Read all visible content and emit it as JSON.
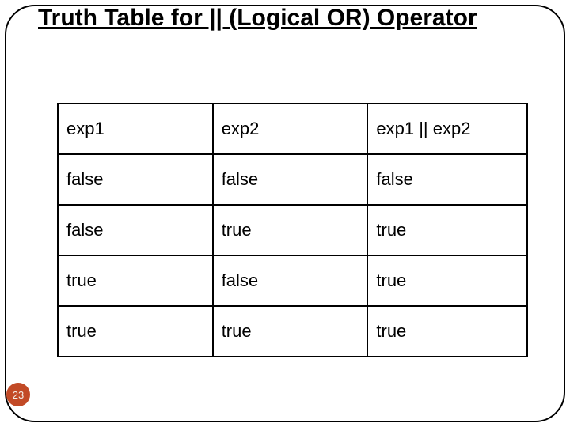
{
  "title": "Truth Table for || (Logical OR) Operator",
  "page_number": "23",
  "chart_data": {
    "type": "table",
    "title": "Truth Table for || (Logical OR) Operator",
    "columns": [
      "exp1",
      "exp2",
      "exp1 || exp2"
    ],
    "rows": [
      [
        "false",
        "false",
        "false"
      ],
      [
        "false",
        "true",
        "true"
      ],
      [
        "true",
        "false",
        "true"
      ],
      [
        "true",
        "true",
        "true"
      ]
    ]
  },
  "headers": {
    "h0": "exp1",
    "h1": "exp2",
    "h2": "exp1 || exp2"
  },
  "rows": {
    "r0": {
      "c0": "false",
      "c1": "false",
      "c2": "false"
    },
    "r1": {
      "c0": "false",
      "c1": "true",
      "c2": "true"
    },
    "r2": {
      "c0": "true",
      "c1": "false",
      "c2": "true"
    },
    "r3": {
      "c0": "true",
      "c1": "true",
      "c2": "true"
    }
  }
}
